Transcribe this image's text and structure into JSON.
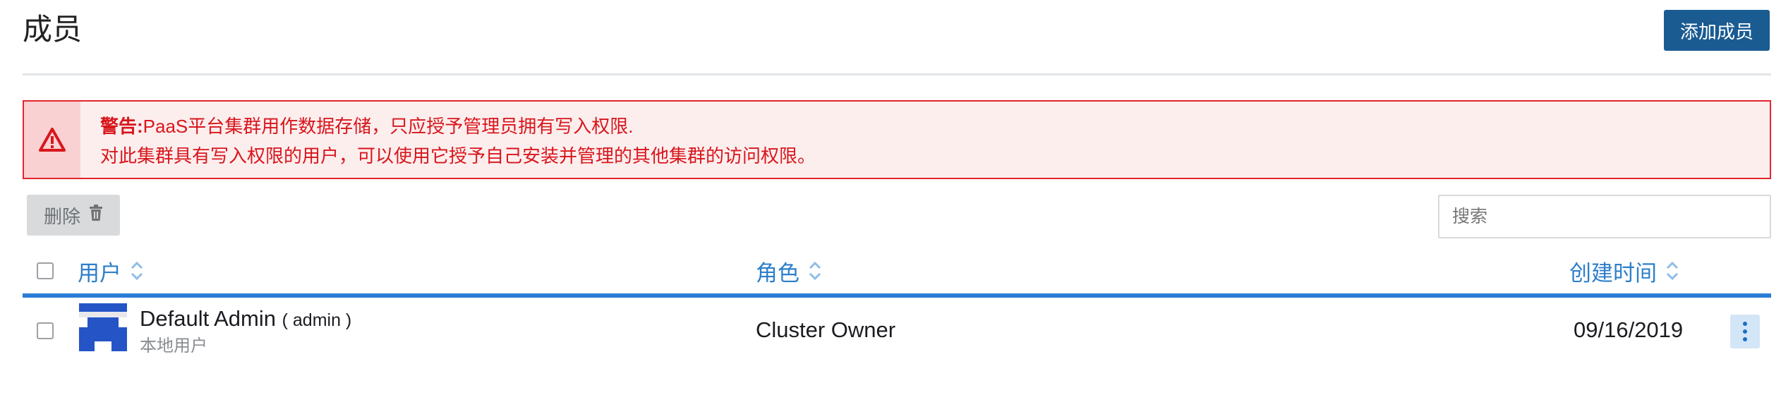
{
  "header": {
    "title": "成员",
    "add_button_label": "添加成员"
  },
  "warning": {
    "strong": "警告:",
    "line1": "PaaS平台集群用作数据存储，只应授予管理员拥有写入权限.",
    "line2": "对此集群具有写入权限的用户，可以使用它授予自己安装并管理的其他集群的访问权限。",
    "icon": "warning-triangle-icon"
  },
  "toolbar": {
    "delete_label": "删除",
    "search_placeholder": "搜索"
  },
  "table": {
    "columns": [
      "用户",
      "角色",
      "创建时间"
    ],
    "rows": [
      {
        "name": "Default Admin",
        "login": "( admin )",
        "sub": "本地用户",
        "role": "Cluster Owner",
        "created": "09/16/2019"
      }
    ]
  },
  "colors": {
    "accent": "#2a7ed6",
    "primary_button": "#1a5b92",
    "warning_red": "#e2262d"
  }
}
